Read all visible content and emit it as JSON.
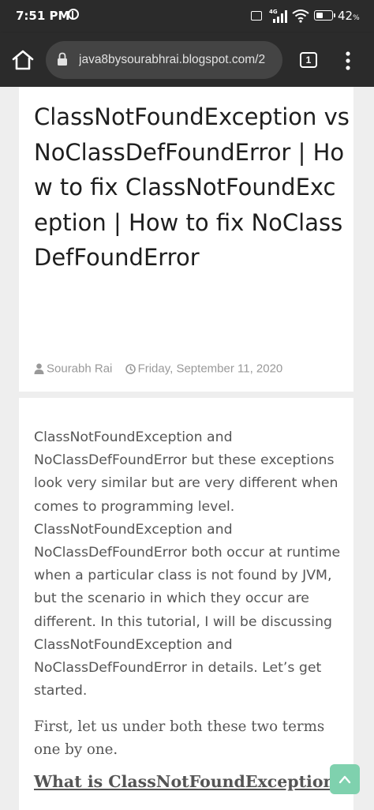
{
  "status_bar": {
    "time": "7:51 PM",
    "network": "4G",
    "volte": "Vo LTE",
    "battery": "42",
    "battery_unit": "%"
  },
  "browser": {
    "url": "java8bysourabhrai.blogspot.com/2",
    "tab_count": "1"
  },
  "post": {
    "title": "ClassNotFoundException vs NoClassDefFoundError | How to fix ClassNotFoundException | How to fix NoClassDefFoundError",
    "author": "Sourabh Rai",
    "date": "Friday, September 11, 2020",
    "intro": "ClassNotFoundException and NoClassDefFoundError but these exceptions look very similar but are very different when comes to programming level. ClassNotFoundException and NoClassDefFoundError both occur at runtime when a particular class is not found by JVM, but the scenario in which they occur are different. In this tutorial, I will be discussing ClassNotFoundException and NoClassDefFoundError in details. Let’s get started.",
    "paragraph_2": "First, let us under both these two terms one by one.",
    "heading_1": "What is ClassNotFoundException"
  },
  "colors": {
    "toolbar": "#2b2b2b",
    "scroll_top_button": "#7fd1ae",
    "body_text": "#555555",
    "meta_text": "#999999"
  }
}
